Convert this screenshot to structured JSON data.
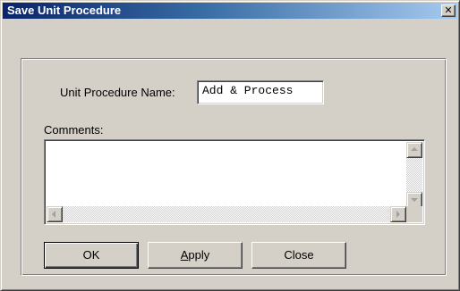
{
  "window": {
    "title": "Save Unit Procedure",
    "close_glyph": "✕"
  },
  "form": {
    "name_label": "Unit Procedure Name:",
    "name_value": "Add & Process",
    "comments_label": "Comments:",
    "comments_value": ""
  },
  "buttons": {
    "ok": "OK",
    "apply_accel": "A",
    "apply_rest": "pply",
    "close": "Close"
  },
  "icons": {
    "scroll_up": "scroll-up-arrow",
    "scroll_down": "scroll-down-arrow",
    "scroll_left": "scroll-left-arrow",
    "scroll_right": "scroll-right-arrow"
  },
  "colors": {
    "face": "#d4d0c8",
    "title_start": "#0a246a",
    "title_end": "#a6caf0"
  }
}
